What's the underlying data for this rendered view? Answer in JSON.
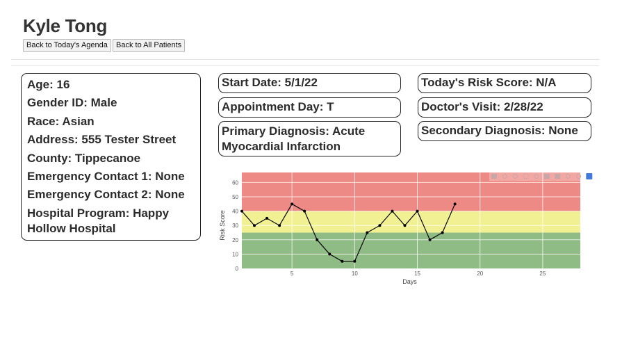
{
  "header": {
    "patient_name": "Kyle Tong",
    "back_agenda_label": "Back to Today's Agenda",
    "back_patients_label": "Back to All Patients"
  },
  "patient_info": {
    "age": "Age: 16",
    "gender": "Gender ID: Male",
    "race": "Race: Asian",
    "address": "Address: 555 Tester Street",
    "county": "County: Tippecanoe",
    "emergency_contact_1": "Emergency Contact 1: None",
    "emergency_contact_2": "Emergency Contact 2: None",
    "hospital_program": "Hospital Program: Happy Hollow Hospital"
  },
  "details": {
    "start_date": "Start Date: 5/1/22",
    "appointment_day": "Appointment Day: T",
    "primary_diagnosis": "Primary Diagnosis: Acute Myocardial Infarction",
    "risk_score": "Today's Risk Score: N/A",
    "doctors_visit": "Doctor's Visit: 2/28/22",
    "secondary_diagnosis": "Secondary Diagnosis: None"
  },
  "modebar_icons": [
    "camera-icon",
    "zoom-icon",
    "pan-icon",
    "box-select-icon",
    "lasso-icon",
    "zoom-in-icon",
    "zoom-out-icon",
    "autoscale-icon",
    "reset-axes-icon",
    "plotly-logo-icon"
  ],
  "chart_data": {
    "type": "line",
    "xlabel": "Days",
    "ylabel": "Risk Score",
    "xlim": [
      1,
      28
    ],
    "ylim": [
      0,
      67
    ],
    "x_ticks": [
      5,
      10,
      15,
      20,
      25
    ],
    "y_ticks": [
      0,
      10,
      20,
      30,
      40,
      50,
      60
    ],
    "bands": [
      {
        "from": 0,
        "to": 25,
        "color": "#8fbc85"
      },
      {
        "from": 25,
        "to": 40,
        "color": "#f1f092"
      },
      {
        "from": 40,
        "to": 67,
        "color": "#ee8a85"
      }
    ],
    "line_color": "#000000",
    "grid": true,
    "series": [
      {
        "x": [
          1,
          2,
          3,
          4,
          5,
          6,
          7,
          8,
          9,
          10,
          11,
          12,
          13,
          14,
          15,
          16,
          17,
          18
        ],
        "values": [
          40,
          30,
          35,
          30,
          45,
          40,
          20,
          10,
          5,
          5,
          25,
          30,
          40,
          30,
          40,
          20,
          25,
          45
        ]
      }
    ]
  }
}
